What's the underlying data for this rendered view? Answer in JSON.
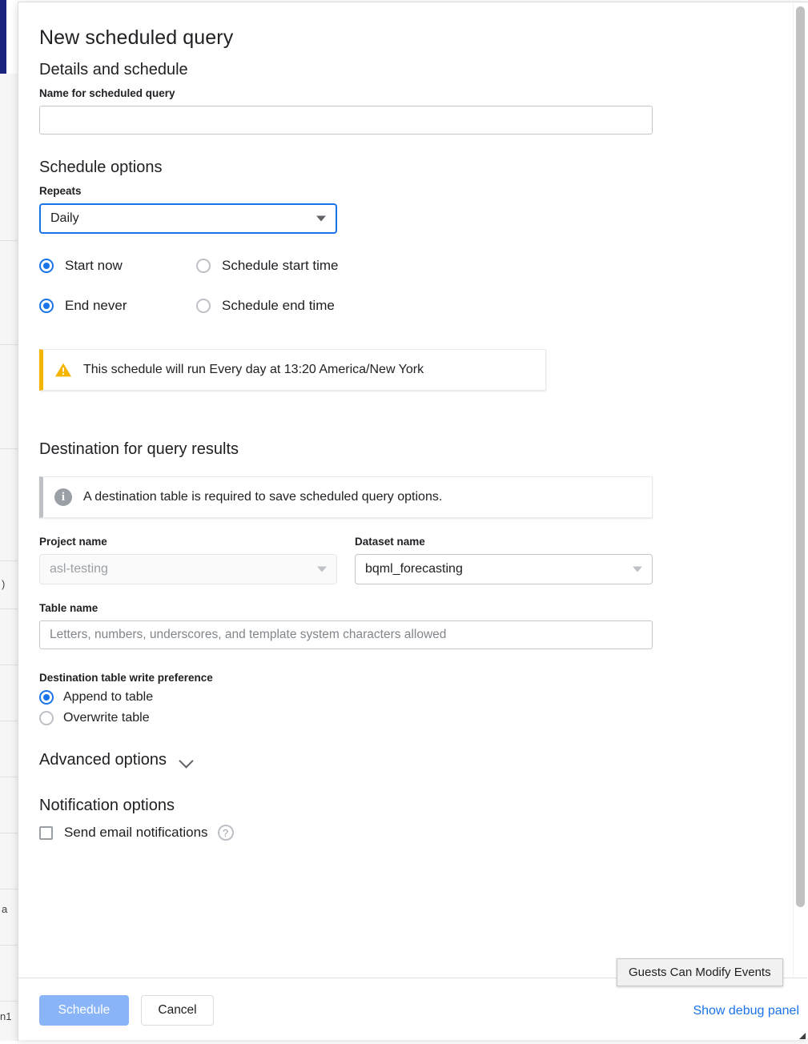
{
  "modal": {
    "title": "New scheduled query",
    "details_section": {
      "heading": "Details and schedule",
      "name_label": "Name for scheduled query",
      "name_value": "",
      "name_placeholder": ""
    },
    "schedule_section": {
      "heading": "Schedule options",
      "repeats_label": "Repeats",
      "repeats_value": "Daily",
      "start_now_label": "Start now",
      "schedule_start_time_label": "Schedule start time",
      "end_never_label": "End never",
      "schedule_end_time_label": "Schedule end time",
      "start_selected": "start-now",
      "end_selected": "end-never",
      "warning_text": "This schedule will run Every day at 13:20 America/New York"
    },
    "destination_section": {
      "heading": "Destination for query results",
      "info_text": "A destination table is required to save scheduled query options.",
      "project_label": "Project name",
      "project_value": "asl-testing",
      "dataset_label": "Dataset name",
      "dataset_value": "bqml_forecasting",
      "table_label": "Table name",
      "table_value": "",
      "table_placeholder": "Letters, numbers, underscores, and template system characters allowed",
      "write_pref_label": "Destination table write preference",
      "append_label": "Append to table",
      "overwrite_label": "Overwrite table",
      "write_pref_selected": "append"
    },
    "advanced_section": {
      "heading": "Advanced options"
    },
    "notification_section": {
      "heading": "Notification options",
      "email_label": "Send email notifications",
      "email_checked": false,
      "help_glyph": "?"
    },
    "footer": {
      "schedule_label": "Schedule",
      "cancel_label": "Cancel",
      "debug_link_label": "Show debug panel"
    }
  },
  "tooltip": {
    "text": "Guests Can Modify Events"
  },
  "icons": {
    "warning_glyph": "!",
    "info_glyph": "i"
  },
  "colors": {
    "accent_blue": "#1a73e8",
    "primary_button": "#8ab4f8",
    "warning_amber": "#f4b400",
    "info_grey": "#bdc1c6",
    "nav_dark_blue": "#1a237e"
  }
}
